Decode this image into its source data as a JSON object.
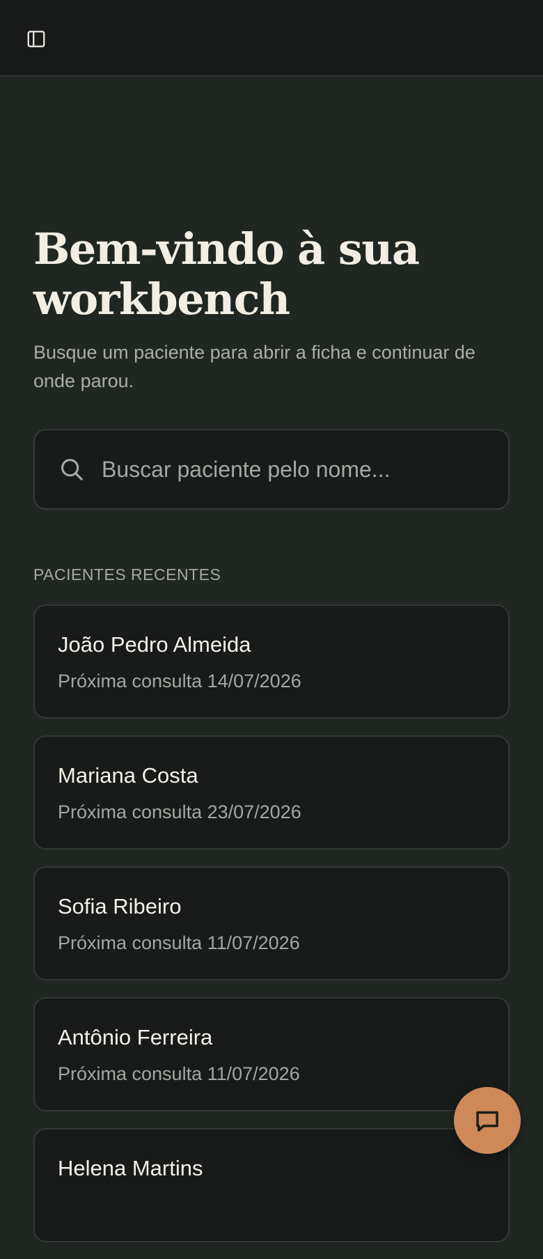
{
  "header": {
    "sidebar_toggle_icon": "sidebar-panel-icon"
  },
  "hero": {
    "title": "Bem-vindo à sua workbench",
    "subtitle": "Busque um paciente para abrir a ficha e continuar de onde parou."
  },
  "search": {
    "icon": "search-icon",
    "placeholder": "Buscar paciente pelo nome...",
    "value": ""
  },
  "recent": {
    "heading": "PACIENTES RECENTES",
    "patients": [
      {
        "name": "João Pedro Almeida",
        "next_appointment": "Próxima consulta 14/07/2026"
      },
      {
        "name": "Mariana Costa",
        "next_appointment": "Próxima consulta 23/07/2026"
      },
      {
        "name": "Sofia Ribeiro",
        "next_appointment": "Próxima consulta 11/07/2026"
      },
      {
        "name": "Antônio Ferreira",
        "next_appointment": "Próxima consulta 11/07/2026"
      },
      {
        "name": "Helena Martins",
        "next_appointment": ""
      }
    ]
  },
  "fab": {
    "icon": "chat-bubble-icon"
  },
  "colors": {
    "background": "#202622",
    "surface": "#181b19",
    "accent": "#cf8857",
    "text_primary": "#f2eee4",
    "text_muted": "#a3a8a2"
  }
}
